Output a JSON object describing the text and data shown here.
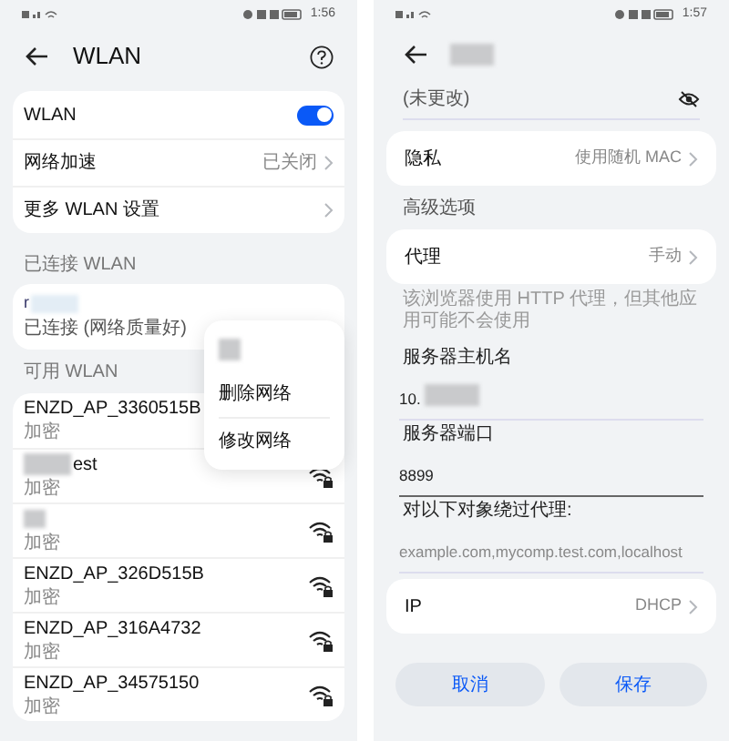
{
  "wlan_screen": {
    "status_bar": {
      "time": "1:56"
    },
    "title": "WLAN",
    "settings": [
      {
        "kind": "toggle",
        "label": "WLAN",
        "on": true
      },
      {
        "kind": "link",
        "label": "网络加速",
        "value": "已关闭"
      },
      {
        "kind": "link",
        "label": "更多 WLAN 设置"
      }
    ],
    "connected_header": "已连接 WLAN",
    "connected": {
      "name": "r",
      "status": "已连接 (网络质量好)"
    },
    "context_menu": [
      "删除网络",
      "修改网络"
    ],
    "available_header": "可用 WLAN",
    "networks": [
      {
        "name": "ENZD_AP_3360515B",
        "security": "加密"
      },
      {
        "name": "est",
        "security": "加密"
      },
      {
        "security": "加密"
      },
      {
        "name": "ENZD_AP_326D515B",
        "security": "加密"
      },
      {
        "name": "ENZD_AP_316A4732",
        "security": "加密"
      },
      {
        "name": "ENZD_AP_34575150",
        "security": "加密"
      }
    ]
  },
  "proxy_screen": {
    "status_bar": {
      "time": "1:57"
    },
    "password_hint": "(未更改)",
    "privacy": {
      "label": "隐私",
      "value": "使用随机 MAC"
    },
    "advanced_header": "高级选项",
    "proxy": {
      "label": "代理",
      "value": "手动"
    },
    "proxy_note": "该浏览器使用 HTTP 代理，但其他应用可能不会使用",
    "fields": [
      {
        "label": "服务器主机名",
        "value": "10.",
        "focused": false
      },
      {
        "label": "服务器端口",
        "value": "8899",
        "focused": true
      },
      {
        "label": "对以下对象绕过代理:",
        "placeholder": "example.com,mycomp.test.com,localhost",
        "focused": false
      }
    ],
    "ip": {
      "label": "IP",
      "value": "DHCP"
    },
    "buttons": [
      "取消",
      "保存"
    ]
  }
}
